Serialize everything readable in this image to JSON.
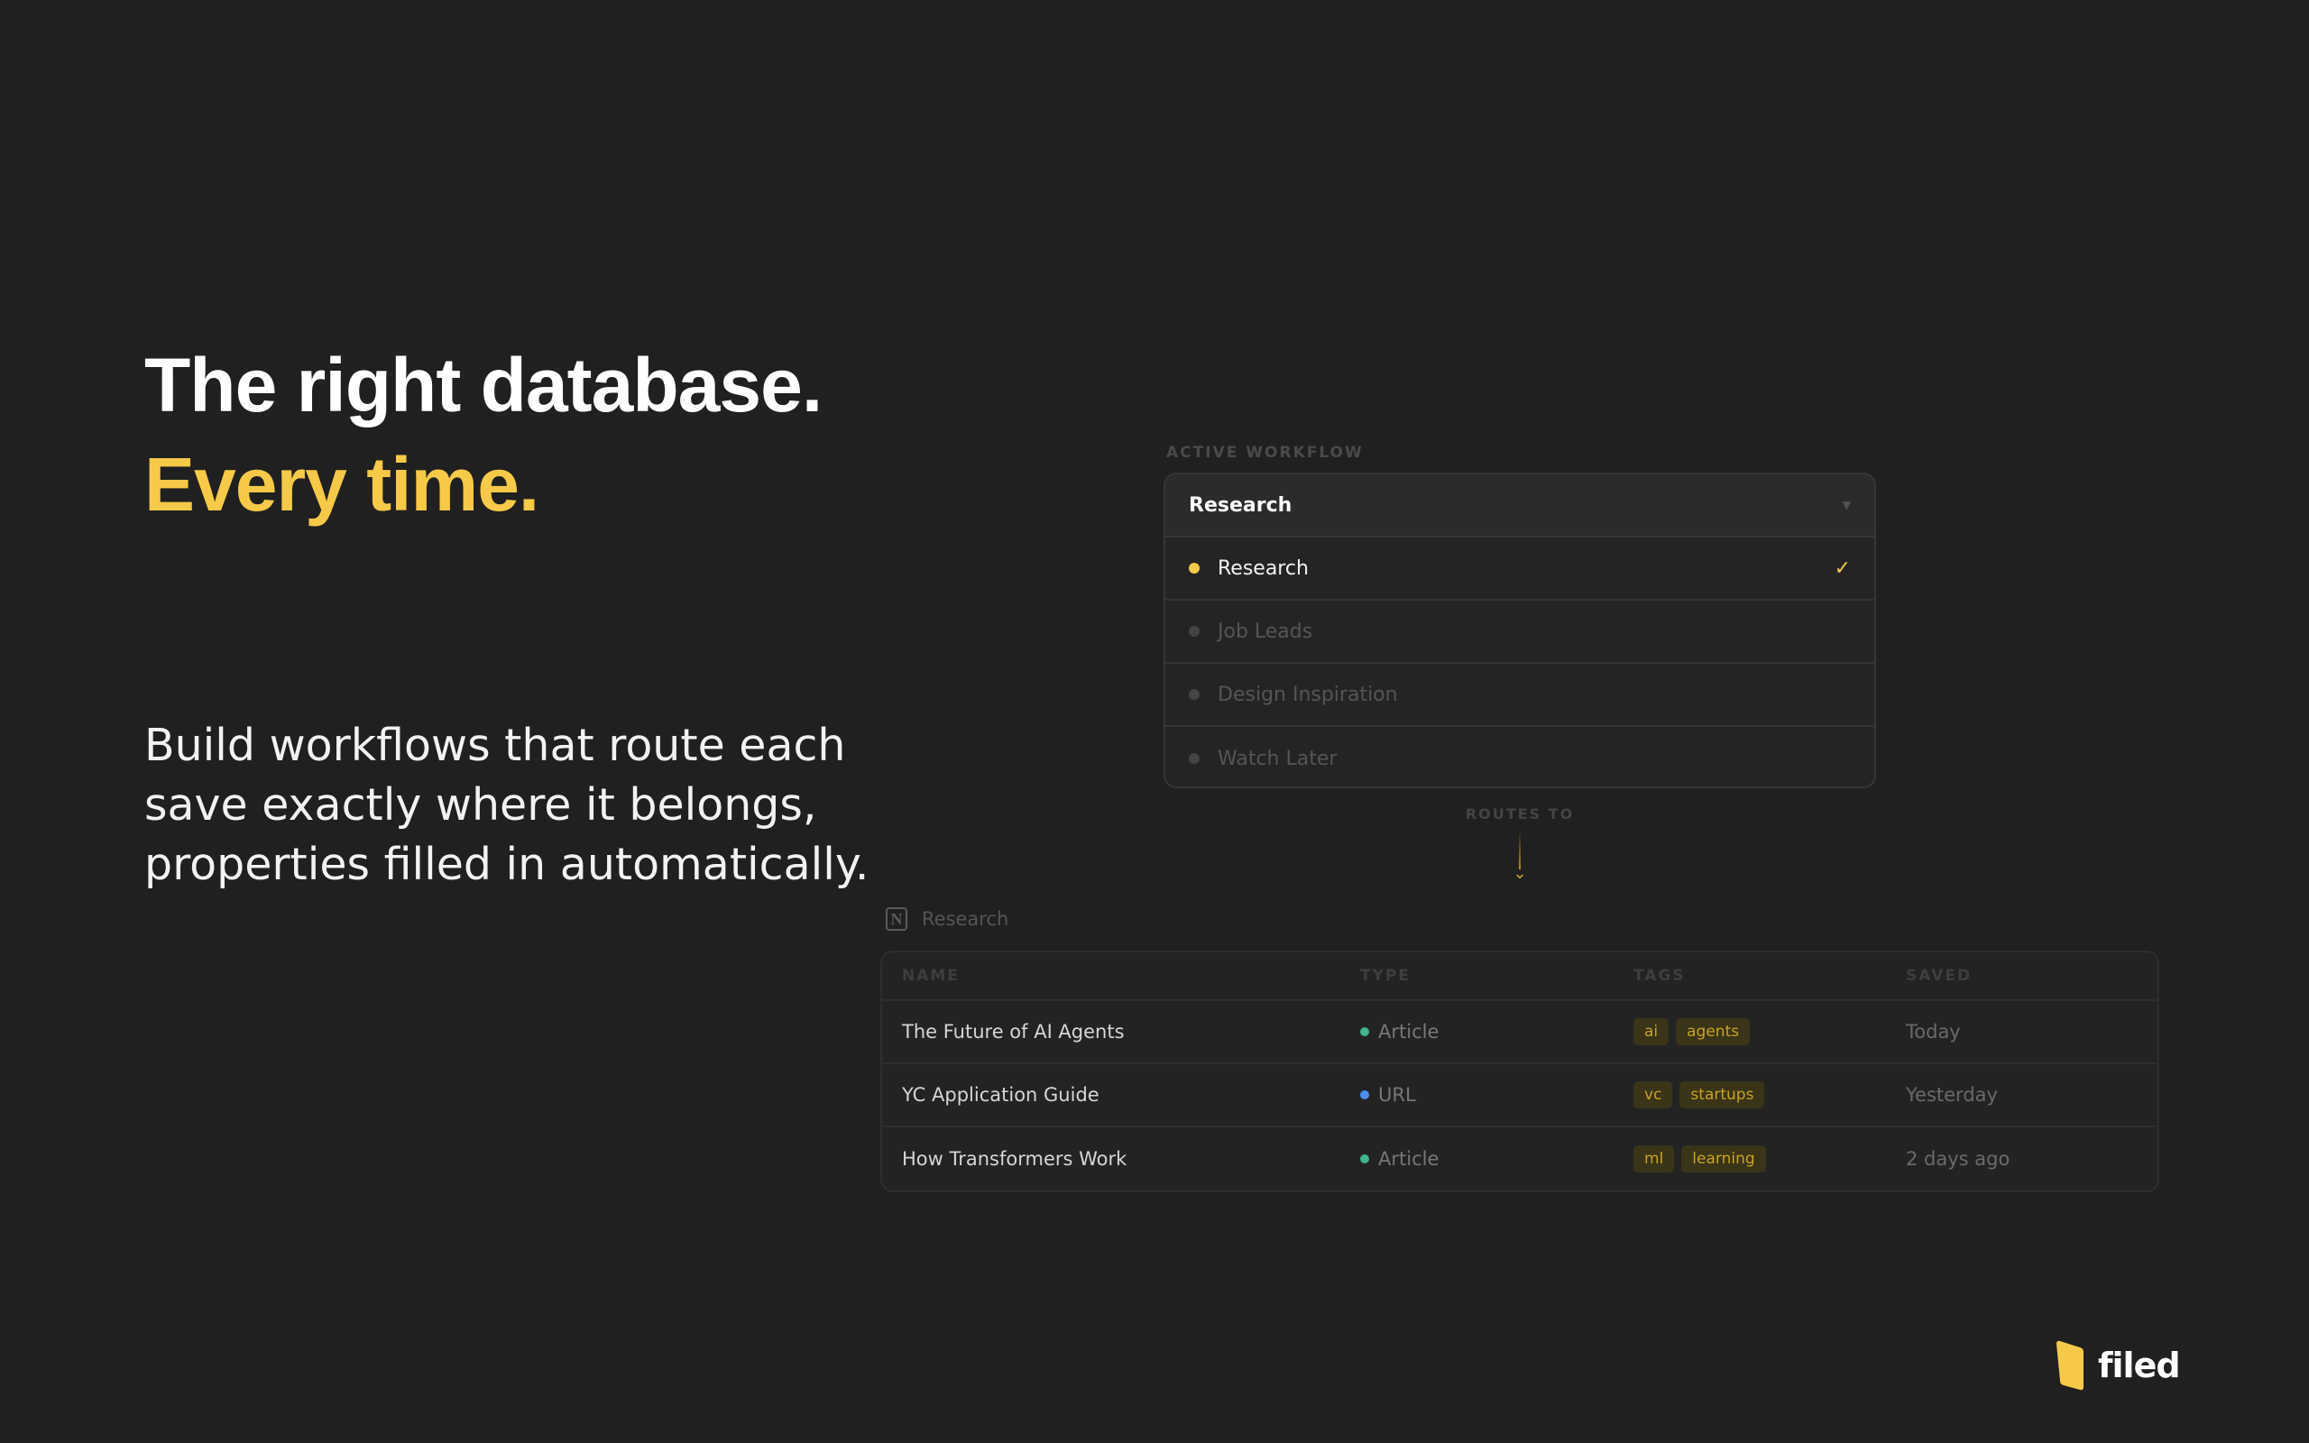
{
  "hero": {
    "title_line1": "The right database.",
    "title_line2": "Every time.",
    "body": "Build workflows that route each save exactly where it belongs, properties filled in automatically."
  },
  "workflow": {
    "label": "ACTIVE WORKFLOW",
    "selected": "Research",
    "caret_icon": "caret-down-icon",
    "options": [
      {
        "name": "Research",
        "selected": true
      },
      {
        "name": "Job Leads",
        "selected": false
      },
      {
        "name": "Design Inspiration",
        "selected": false
      },
      {
        "name": "Watch Later",
        "selected": false
      }
    ],
    "check_glyph": "✓"
  },
  "routes": {
    "label": "ROUTES TO",
    "chevron_glyph": "⌄"
  },
  "database": {
    "icon": "notion-icon",
    "icon_glyph": "N",
    "name": "Research",
    "columns": [
      "NAME",
      "TYPE",
      "TAGS",
      "SAVED"
    ],
    "rows": [
      {
        "name": "The Future of AI Agents",
        "type": "Article",
        "type_color": "#3fb68b",
        "tags": [
          "ai",
          "agents"
        ],
        "saved": "Today"
      },
      {
        "name": "YC Application Guide",
        "type": "URL",
        "type_color": "#4a8ff0",
        "tags": [
          "vc",
          "startups"
        ],
        "saved": "Yesterday"
      },
      {
        "name": "How Transformers Work",
        "type": "Article",
        "type_color": "#3fb68b",
        "tags": [
          "ml",
          "learning"
        ],
        "saved": "2 days ago"
      }
    ]
  },
  "brand": {
    "logo": "filed-logo-icon",
    "name": "filed"
  },
  "colors": {
    "background": "#202020",
    "accent": "#f7c948"
  }
}
